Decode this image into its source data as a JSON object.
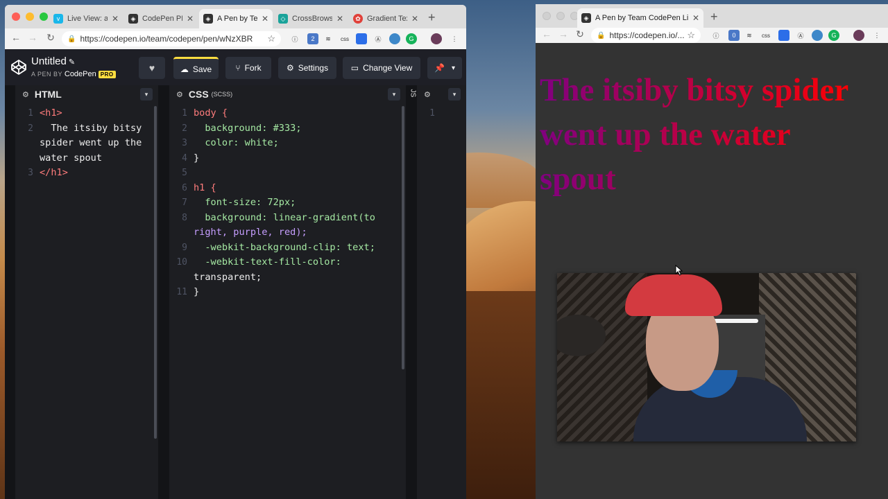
{
  "left_window": {
    "tabs": [
      {
        "title": "Live View: a C",
        "icon": "vimeo-icon",
        "color": "#1ab7ea"
      },
      {
        "title": "CodePen PRO",
        "icon": "codepen-icon",
        "color": "#333333"
      },
      {
        "title": "A Pen by Team",
        "icon": "codepen-icon",
        "color": "#333333",
        "active": true
      },
      {
        "title": "CrossBrowser",
        "icon": "crossbrowser-icon",
        "color": "#1aa39a"
      },
      {
        "title": "Gradient Text",
        "icon": "gradient-icon",
        "color": "#e0413a"
      }
    ],
    "url": "https://codepen.io/team/codepen/pen/wNzXBR",
    "extensions_badge": "2",
    "css_ext": "css"
  },
  "codepen": {
    "title": "Untitled",
    "subtitle_prefix": "A PEN BY",
    "owner": "CodePen",
    "pro": "PRO",
    "buttons": {
      "save": "Save",
      "fork": "Fork",
      "settings": "Settings",
      "change_view": "Change View"
    }
  },
  "html_pane": {
    "label": "HTML",
    "lines": [
      {
        "n": "1",
        "text": "<h1>"
      },
      {
        "n": "2",
        "text": "  The itsiby bitsy"
      },
      {
        "n": "",
        "text": "spider went up the"
      },
      {
        "n": "",
        "text": "water spout"
      },
      {
        "n": "3",
        "text": "</h1>"
      }
    ]
  },
  "css_pane": {
    "label": "CSS",
    "sublabel": "(SCSS)",
    "lines": [
      {
        "n": "1",
        "text": "body {"
      },
      {
        "n": "2",
        "text": "  background: #333;"
      },
      {
        "n": "3",
        "text": "  color: white;"
      },
      {
        "n": "4",
        "text": "}"
      },
      {
        "n": "5",
        "text": ""
      },
      {
        "n": "6",
        "text": "h1 {"
      },
      {
        "n": "7",
        "text": "  font-size: 72px;"
      },
      {
        "n": "8",
        "text": "  background: linear-gradient(to"
      },
      {
        "n": "",
        "text": "right, purple, red);"
      },
      {
        "n": "9",
        "text": "  -webkit-background-clip: text;"
      },
      {
        "n": "10",
        "text": "  -webkit-text-fill-color:"
      },
      {
        "n": "",
        "text": "transparent;"
      },
      {
        "n": "11",
        "text": "}"
      }
    ]
  },
  "js_pane": {
    "label": "JS",
    "lines": [
      {
        "n": "1",
        "text": ""
      }
    ]
  },
  "right_window": {
    "tab_title": "A Pen by Team CodePen Live P",
    "url": "https://codepen.io/...",
    "extensions_badge": "0",
    "css_ext": "css"
  },
  "preview": {
    "heading": "The itsiby bitsy spider went up the water spout",
    "gradient_from": "purple",
    "gradient_to": "red",
    "background": "#333333"
  },
  "colors": {
    "codepen_header": "#1e1f26",
    "editor_bg": "#1d1e22",
    "save_accent": "#ffdd40"
  }
}
